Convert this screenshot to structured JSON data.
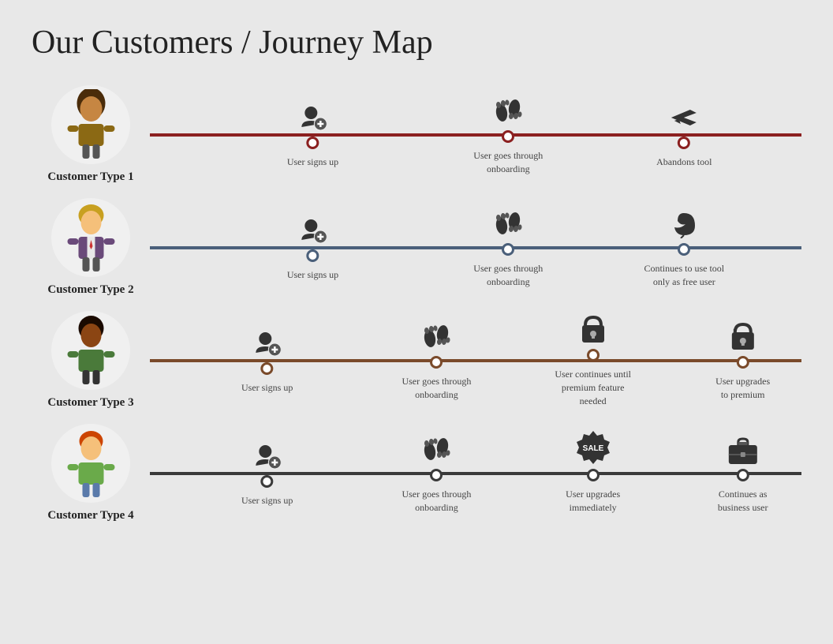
{
  "title": {
    "bold": "Our Customers",
    "light": " / Journey Map"
  },
  "rows": [
    {
      "id": "row1",
      "customerLabel": "Customer Type 1",
      "lineColor": "red",
      "avatarType": "woman-brown",
      "steps": [
        {
          "icon": "👤➕",
          "iconType": "signup",
          "label": "User signs up",
          "pos": 25
        },
        {
          "icon": "👣",
          "iconType": "footprints",
          "label": "User goes through onboarding",
          "pos": 55
        },
        {
          "icon": "✈️",
          "iconType": "plane",
          "label": "Abandons tool",
          "pos": 82
        }
      ]
    },
    {
      "id": "row2",
      "customerLabel": "Customer Type 2",
      "lineColor": "blue",
      "avatarType": "man-blond",
      "steps": [
        {
          "icon": "👤➕",
          "iconType": "signup",
          "label": "User signs up",
          "pos": 25
        },
        {
          "icon": "👣",
          "iconType": "footprints",
          "label": "User goes through onboarding",
          "pos": 55
        },
        {
          "icon": "🌿",
          "iconType": "leaf",
          "label": "Continues to use tool only as free user",
          "pos": 82
        }
      ]
    },
    {
      "id": "row3",
      "customerLabel": "Customer Type 3",
      "lineColor": "brown",
      "avatarType": "woman-dark",
      "steps": [
        {
          "icon": "👤➕",
          "iconType": "signup",
          "label": "User signs up",
          "pos": 18
        },
        {
          "icon": "👣",
          "iconType": "footprints",
          "label": "User goes through onboarding",
          "pos": 44
        },
        {
          "icon": "🔒",
          "iconType": "lock-closed",
          "label": "User continues until premium feature needed",
          "pos": 68
        },
        {
          "icon": "🔓",
          "iconType": "lock-open",
          "label": "User upgrades to premium",
          "pos": 91
        }
      ]
    },
    {
      "id": "row4",
      "customerLabel": "Customer Type 4",
      "lineColor": "dark",
      "avatarType": "boy-red",
      "steps": [
        {
          "icon": "👤➕",
          "iconType": "signup",
          "label": "User signs up",
          "pos": 18
        },
        {
          "icon": "👣",
          "iconType": "footprints",
          "label": "User goes through onboarding",
          "pos": 44
        },
        {
          "icon": "SALE",
          "iconType": "sale",
          "label": "User upgrades immediately",
          "pos": 68
        },
        {
          "icon": "💼",
          "iconType": "briefcase",
          "label": "Continues as business user",
          "pos": 91
        }
      ]
    }
  ]
}
